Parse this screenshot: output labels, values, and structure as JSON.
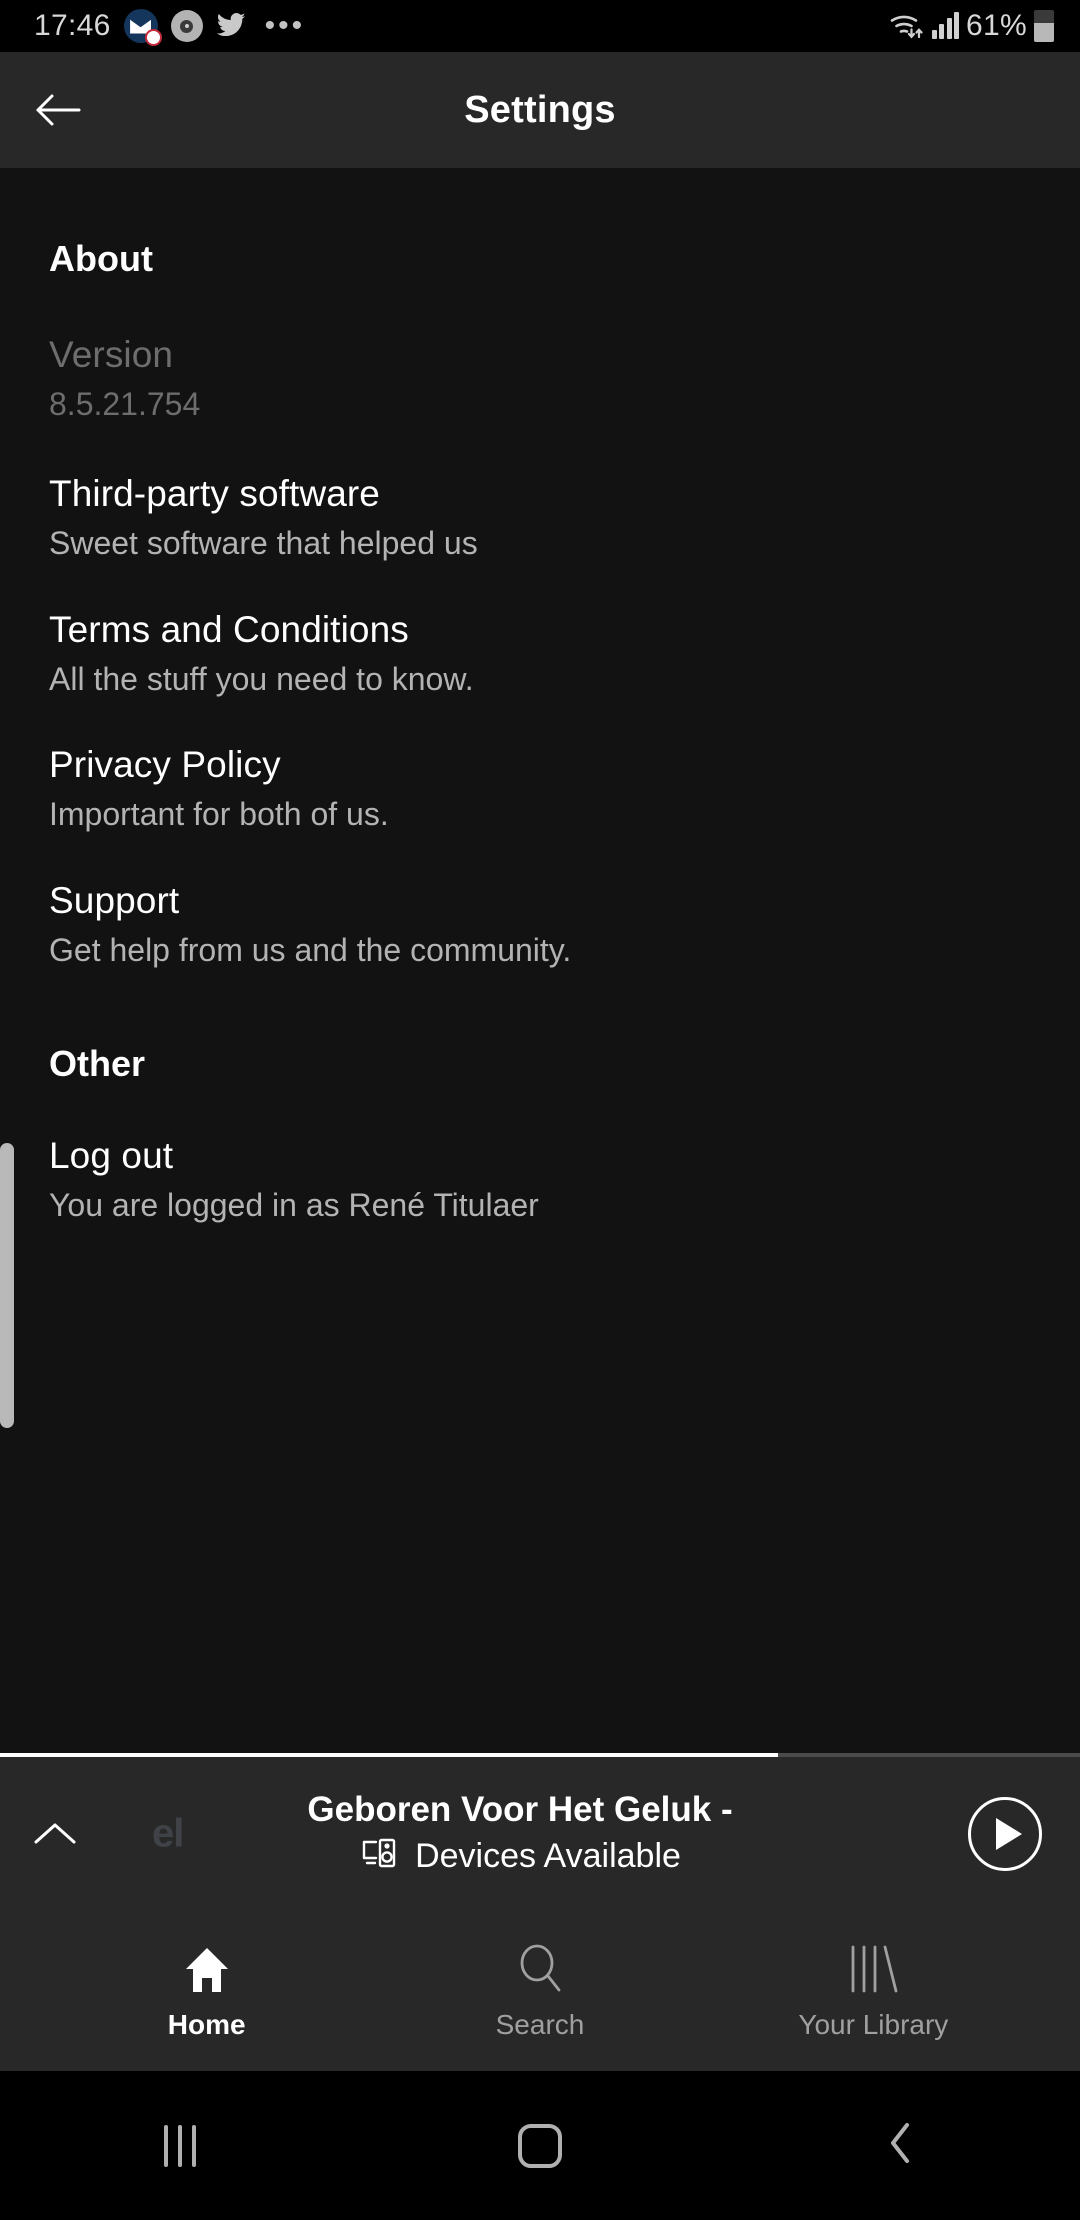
{
  "status_bar": {
    "time": "17:46",
    "icons": [
      "mail-icon",
      "disc-icon",
      "twitter-icon",
      "overflow-dots-icon"
    ],
    "overflow": "•••",
    "wifi": "wifi-icon",
    "signal": "signal-bars-icon",
    "battery_percent": "61%",
    "battery": "battery-icon"
  },
  "app_bar": {
    "back": "back-arrow-icon",
    "title": "Settings"
  },
  "sections": [
    {
      "heading": "About",
      "rows": [
        {
          "title": "Version",
          "subtitle": "8.5.21.754",
          "style": "dim"
        },
        {
          "title": "Third-party software",
          "subtitle": "Sweet software that helped us",
          "style": "normal"
        },
        {
          "title": "Terms and Conditions",
          "subtitle": "All the stuff you need to know.",
          "style": "normal"
        },
        {
          "title": "Privacy Policy",
          "subtitle": "Important for both of us.",
          "style": "normal"
        },
        {
          "title": "Support",
          "subtitle": "Get help from us and the community.",
          "style": "normal"
        }
      ]
    },
    {
      "heading": "Other",
      "rows": [
        {
          "title": "Log out",
          "subtitle": "You are logged in as René Titulaer",
          "style": "normal"
        }
      ]
    }
  ],
  "now_playing": {
    "expand": "chevron-up-icon",
    "album_art_text": "el",
    "track": "Geboren Voor Het Geluk -",
    "devices_icon": "devices-icon",
    "devices_label": "Devices Available",
    "play": "play-icon",
    "progress_percent": 72
  },
  "bottom_nav": {
    "items": [
      {
        "label": "Home",
        "icon": "home-icon",
        "active": true
      },
      {
        "label": "Search",
        "icon": "search-icon",
        "active": false
      },
      {
        "label": "Your Library",
        "icon": "library-icon",
        "active": false
      }
    ]
  },
  "system_nav": {
    "recents": "recents-icon",
    "home": "home-square-icon",
    "back": "back-chevron-icon"
  },
  "colors": {
    "app_background": "#121212",
    "surface": "#282828",
    "text_primary": "#ffffff",
    "text_secondary": "#b3b3b3",
    "text_disabled": "#6d6d6d"
  }
}
